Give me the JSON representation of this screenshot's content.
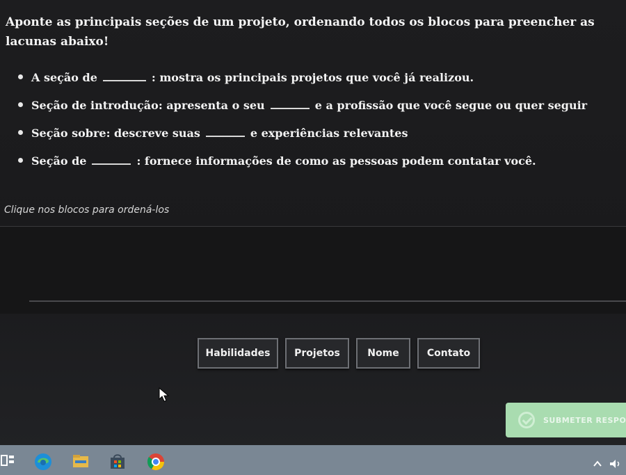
{
  "question": {
    "text": "Aponte as principais seções de um projeto, ordenando todos os blocos para preencher as lacunas abaixo!"
  },
  "items": [
    {
      "before": "A seção de",
      "after": ": mostra os principais projetos que você já realizou."
    },
    {
      "before": "Seção de introdução: apresenta o seu",
      "after": "e a profissão que você segue ou quer seguir"
    },
    {
      "before": "Seção sobre: descreve suas",
      "after": "e experiências relevantes"
    },
    {
      "before": "Seção de",
      "after": ": fornece informações de como as pessoas podem contatar você."
    }
  ],
  "instructions": "Clique nos blocos para ordená-los",
  "blocks": [
    "Habilidades",
    "Projetos",
    "Nome",
    "Contato"
  ],
  "submit": {
    "label": "SUBMETER RESPO",
    "icon": "check-circle-icon"
  },
  "taskbar": {
    "icons": [
      "task-view-icon",
      "edge-icon",
      "file-explorer-icon",
      "store-icon",
      "chrome-icon"
    ],
    "tray_icons": [
      "chevron-up-icon",
      "volume-icon"
    ]
  },
  "colors": {
    "background": "#1d1d1f",
    "submit": "#a9dcb0",
    "taskbar": "#7a8794"
  }
}
